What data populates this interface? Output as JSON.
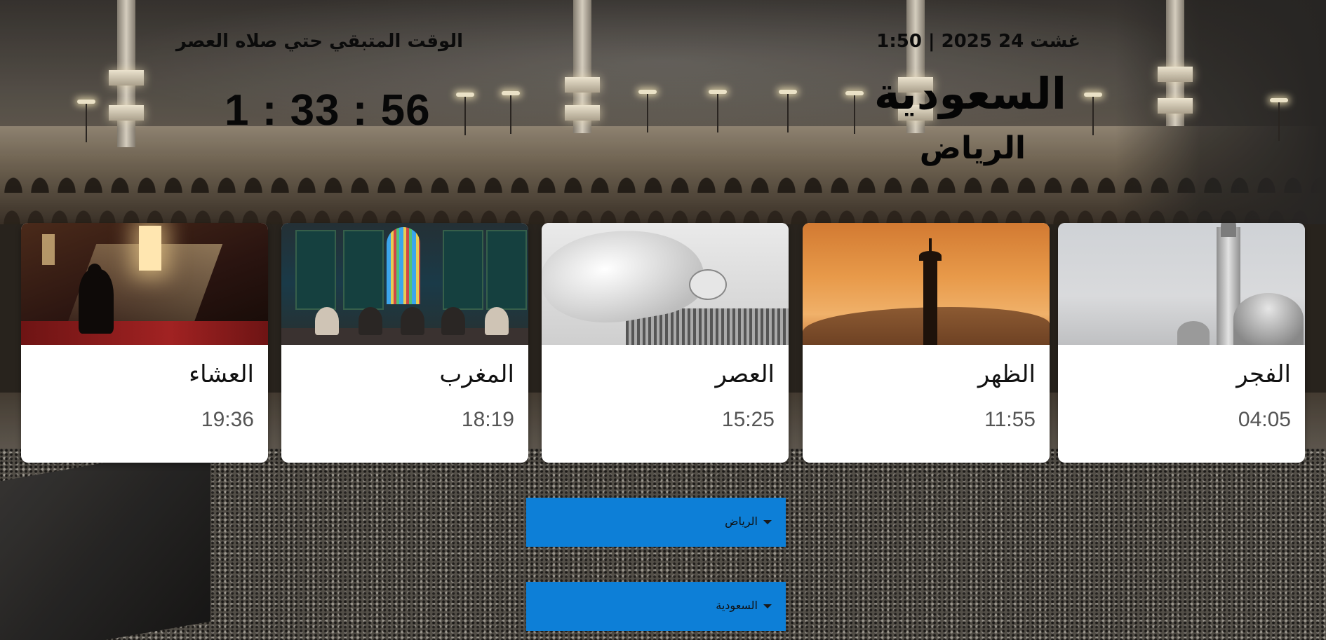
{
  "header": {
    "date_time": "غشت 24 2025 | 1:50",
    "country": "السعودية",
    "city": "الرياض",
    "countdown_label": "الوقت المتبقي حتي صلاه العصر",
    "countdown": "1 : 33 : 56"
  },
  "prayers": [
    {
      "name": "العشاء",
      "time": "19:36",
      "image": "praying-man-sunlight"
    },
    {
      "name": "المغرب",
      "time": "18:19",
      "image": "mosque-interior-congregation"
    },
    {
      "name": "العصر",
      "time": "15:25",
      "image": "man-prostrating-prayer-rug"
    },
    {
      "name": "الظهر",
      "time": "11:55",
      "image": "minaret-sunset-silhouette"
    },
    {
      "name": "الفجر",
      "time": "04:05",
      "image": "mosque-minaret-domes"
    }
  ],
  "selects": {
    "city": {
      "value": "الرياض"
    },
    "country": {
      "value": "السعودية"
    }
  },
  "colors": {
    "select_background": "#0d7fd7",
    "card_background": "#ffffff",
    "heading_text": "#050505",
    "time_text": "#555555"
  },
  "icons": {
    "select_caret": "chevron-down-icon"
  }
}
